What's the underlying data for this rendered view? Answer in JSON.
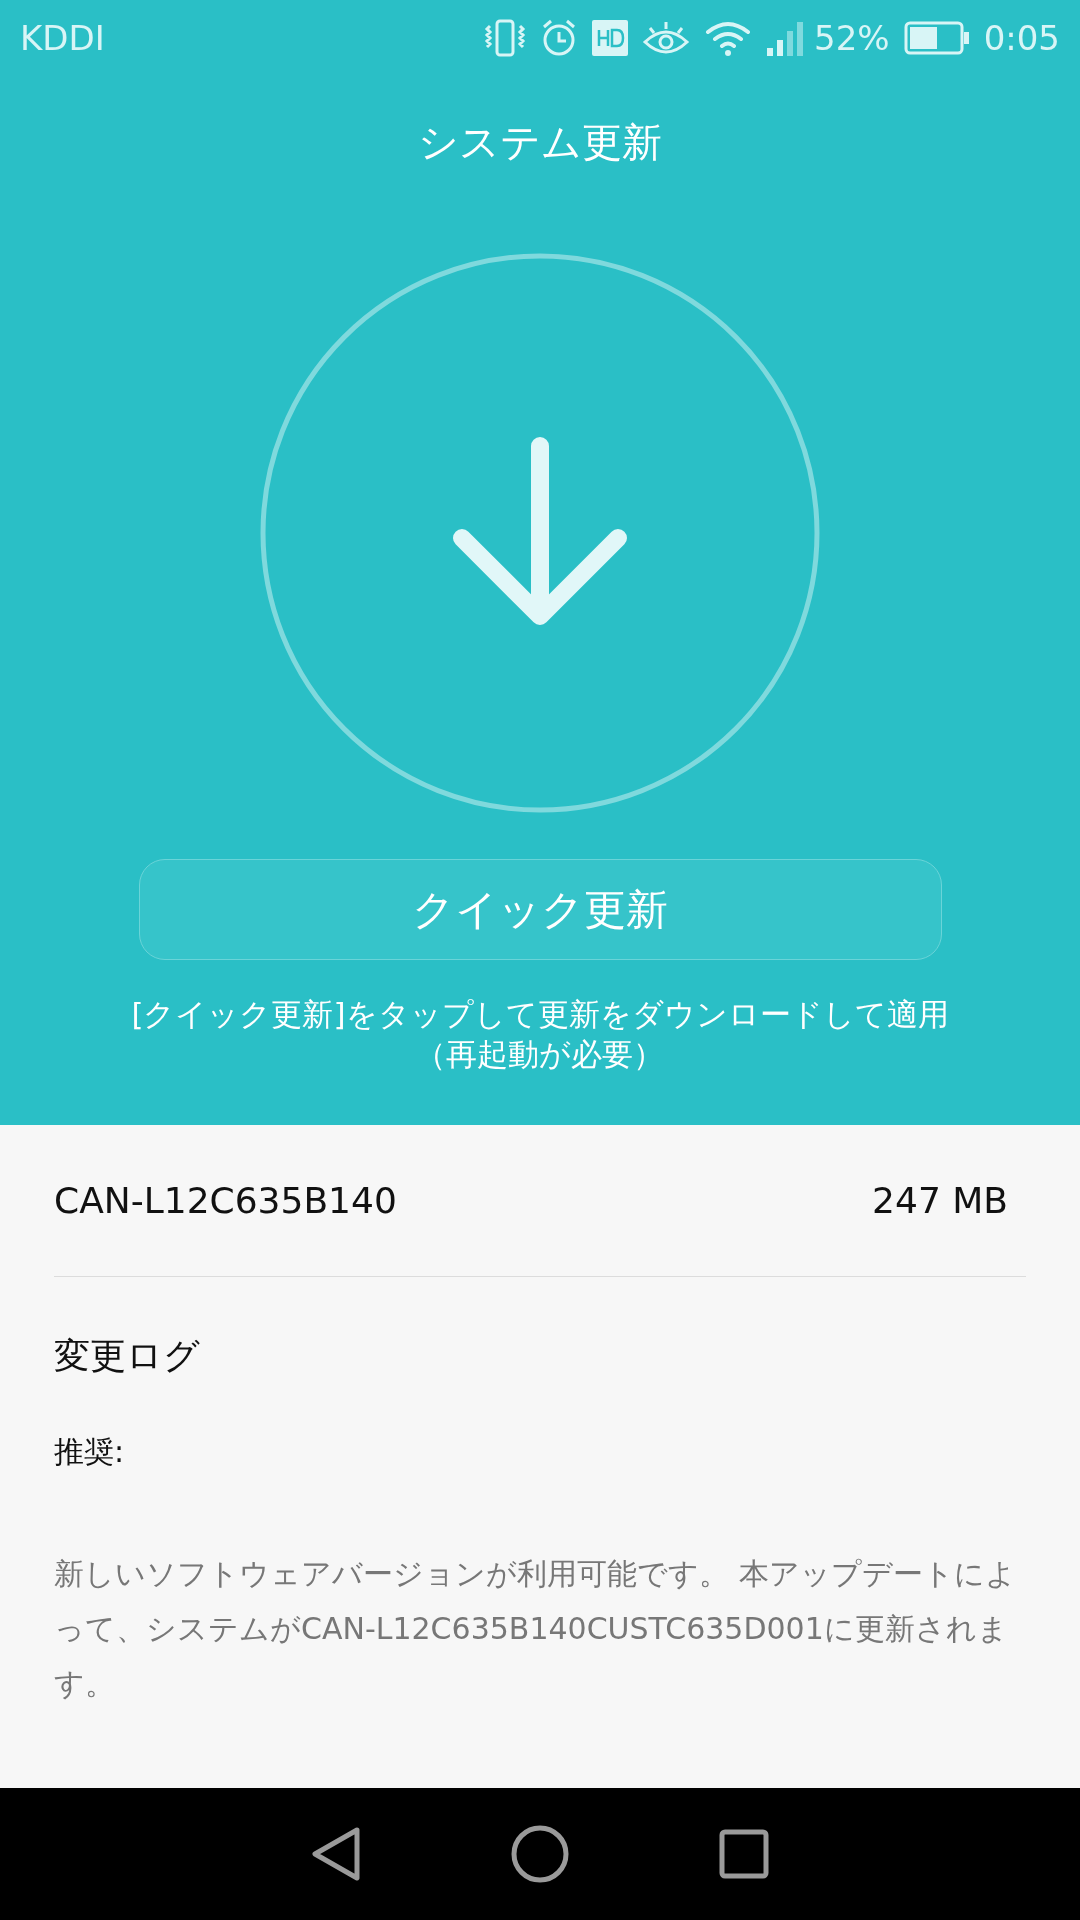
{
  "status_bar": {
    "carrier": "KDDI",
    "battery_percent": "52%",
    "time": "0:05"
  },
  "title": "システム更新",
  "quick_update_button": "クイック更新",
  "hint": [
    "[クイック更新]をタップして更新をダウンロードして適用",
    "（再起動が必要）"
  ],
  "package": {
    "name": "CAN-L12C635B140",
    "size": "247 MB"
  },
  "changelog": {
    "heading": "変更ログ",
    "label": "推奨:",
    "text": "新しいソフトウェアバージョンが利用可能です。 本アップデートによって、システムがCAN-L12C635B140CUSTC635D001に更新されます。"
  }
}
